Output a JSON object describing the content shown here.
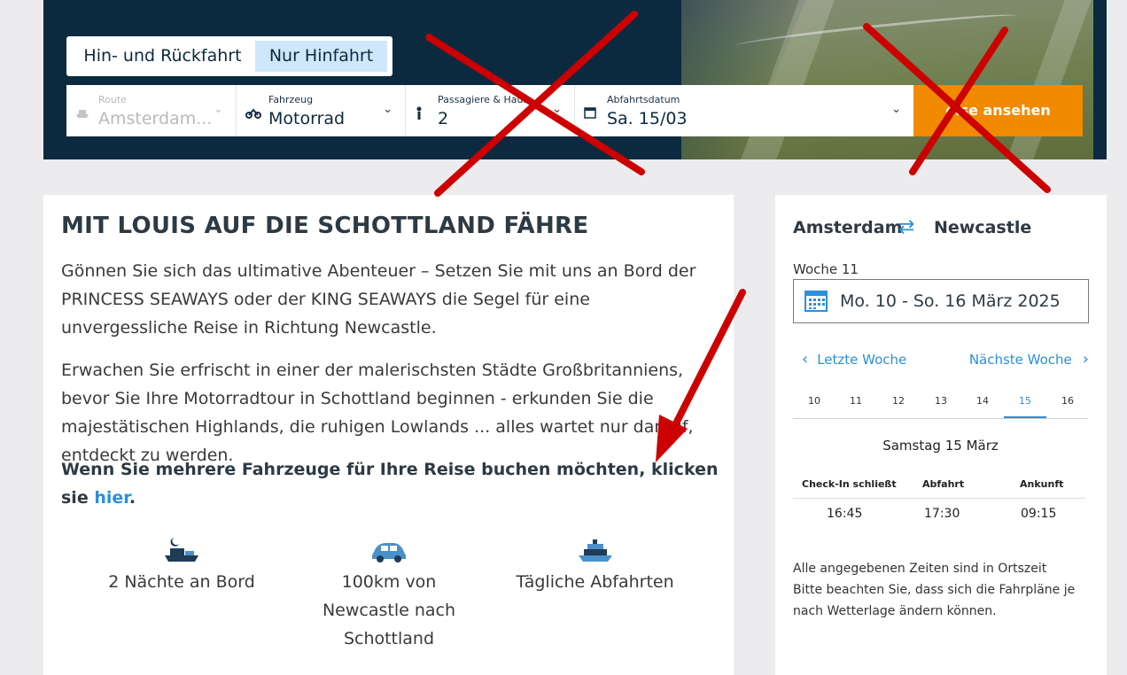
{
  "trip_toggle": {
    "round_trip": "Hin- und Rückfahrt",
    "one_way": "Nur Hinfahrt"
  },
  "search": {
    "route_label": "Route",
    "route_value": "Amsterdam...",
    "vehicle_label": "Fahrzeug",
    "vehicle_value": "Motorrad",
    "passengers_label": "Passagiere & Haus",
    "passengers_value": "2",
    "date_label": "Abfahrtsdatum",
    "date_value": "Sa. 15/03",
    "cta": "eise ansehen"
  },
  "article": {
    "title": "MIT LOUIS AUF DIE SCHOTTLAND FÄHRE",
    "p1": "Gönnen Sie sich das ultimative Abenteuer – Setzen Sie mit uns an Bord der PRINCESS SEAWAYS oder der KING SEAWAYS die Segel für eine unvergessliche Reise in Richtung Newcastle.",
    "p2": "Erwachen Sie erfrischt in einer der malerischsten Städte Großbritanniens, bevor Sie Ihre Motorradtour in Schottland beginnen - erkunden Sie die majestätischen Highlands, die ruhigen Lowlands ... alles wartet nur darauf, entdeckt zu werden.",
    "p3_text": "Wenn Sie mehrere Fahrzeuge für Ihre Reise buchen möchten, klicken sie ",
    "p3_link": "hier",
    "p3_end": ".",
    "features": [
      "2 Nächte an Bord",
      "100km von Newcastle nach Schottland",
      "Tägliche Abfahrten"
    ]
  },
  "schedule": {
    "from": "Amsterdam",
    "to": "Newcastle",
    "week_label": "Woche 11",
    "date_range": "Mo. 10 - So. 16 März 2025",
    "prev": "Letzte Woche",
    "next": "Nächste Woche",
    "days": [
      "10",
      "11",
      "12",
      "13",
      "14",
      "15",
      "16"
    ],
    "active_day": "15",
    "day_name": "Samstag 15 März",
    "headers": [
      "Check-In schließt",
      "Abfahrt",
      "Ankunft"
    ],
    "times": [
      "16:45",
      "17:30",
      "09:15"
    ],
    "note_1": "Alle angegebenen Zeiten sind in Ortszeit",
    "note_2": "Bitte beachten Sie, dass sich die Fahrpläne je nach Wetterlage ändern können."
  },
  "colors": {
    "navy": "#0b2a3f",
    "accent_blue": "#2b8fd9",
    "cta_orange": "#f18a00",
    "annotation_red": "#cc0000"
  }
}
